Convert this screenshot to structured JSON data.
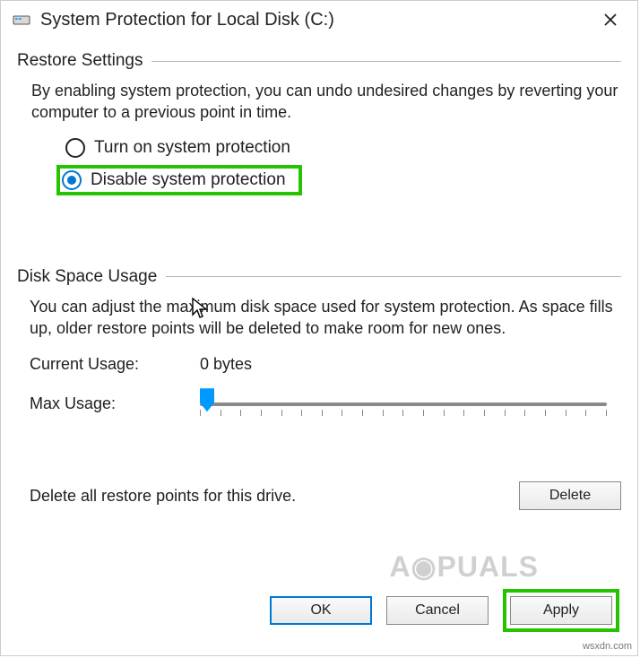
{
  "title": "System Protection for Local Disk (C:)",
  "restore": {
    "header": "Restore Settings",
    "description": "By enabling system protection, you can undo undesired changes by reverting your computer to a previous point in time.",
    "option_on": "Turn on system protection",
    "option_off": "Disable system protection",
    "selected": "off"
  },
  "usage": {
    "header": "Disk Space Usage",
    "description": "You can adjust the maximum disk space used for system protection. As space fills up, older restore points will be deleted to make room for new ones.",
    "current_label": "Current Usage:",
    "current_value": "0 bytes",
    "max_label": "Max Usage:",
    "slider_value": 0
  },
  "delete": {
    "text": "Delete all restore points for this drive.",
    "button": "Delete"
  },
  "buttons": {
    "ok": "OK",
    "cancel": "Cancel",
    "apply": "Apply"
  },
  "watermark": "APPUALS",
  "credit": "wsxdn.com"
}
